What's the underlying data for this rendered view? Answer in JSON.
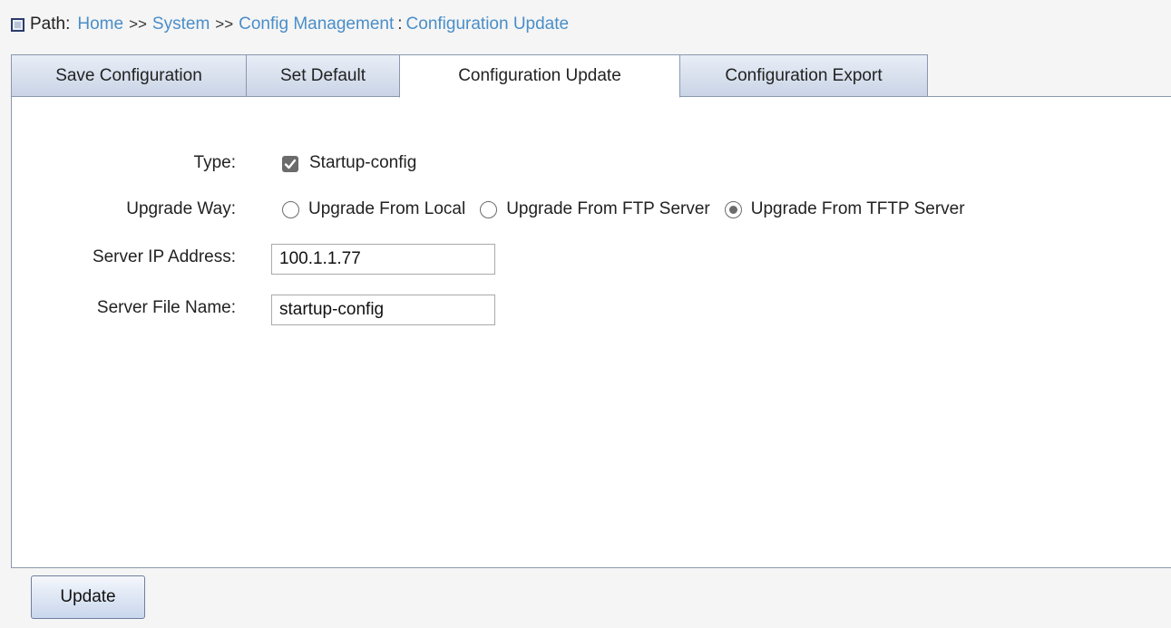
{
  "breadcrumb": {
    "label": "Path:",
    "home": "Home",
    "sep1": ">>",
    "system": "System",
    "sep2": ">>",
    "config_management": "Config Management",
    "colon": ":",
    "current": "Configuration Update",
    "icon": "path-square-icon"
  },
  "tabs": {
    "save": "Save Configuration",
    "default": "Set Default",
    "update": "Configuration Update",
    "export": "Configuration Export",
    "active": "Configuration Update"
  },
  "form": {
    "type_label": "Type:",
    "type_option": "Startup-config",
    "type_checked": true,
    "upgrade_way_label": "Upgrade Way:",
    "upgrade_options": {
      "local": "Upgrade From Local",
      "ftp": "Upgrade From FTP Server",
      "tftp": "Upgrade From TFTP Server"
    },
    "upgrade_selected": "Upgrade From TFTP Server",
    "server_ip_label": "Server IP Address:",
    "server_ip_value": "100.1.1.77",
    "server_file_label": "Server File Name:",
    "server_file_value": "startup-config"
  },
  "actions": {
    "update": "Update"
  },
  "colors": {
    "link": "#4a8ec8",
    "tab_border": "#8a97ad",
    "page_bg": "#f5f5f5"
  }
}
